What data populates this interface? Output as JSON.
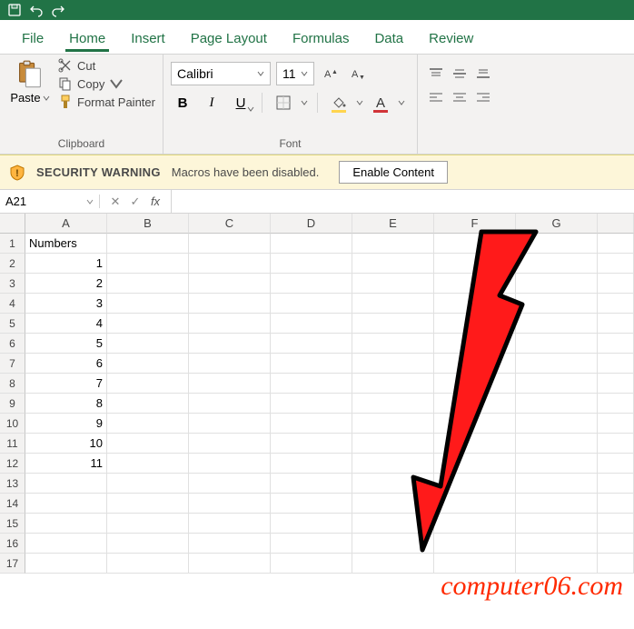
{
  "tabs": {
    "file": "File",
    "home": "Home",
    "insert": "Insert",
    "pageLayout": "Page Layout",
    "formulas": "Formulas",
    "data": "Data",
    "review": "Review"
  },
  "clipboard": {
    "paste": "Paste",
    "cut": "Cut",
    "copy": "Copy",
    "formatPainter": "Format Painter",
    "groupLabel": "Clipboard"
  },
  "font": {
    "name": "Calibri",
    "size": "11",
    "bold": "B",
    "italic": "I",
    "underline": "U",
    "fontColor": "#d13438",
    "fillColor": "#ffd54f",
    "groupLabel": "Font"
  },
  "security": {
    "title": "SECURITY WARNING",
    "message": "Macros have been disabled.",
    "enable": "Enable Content"
  },
  "formulaBar": {
    "nameBox": "A21",
    "cancel": "✕",
    "confirm": "✓",
    "fx": "fx",
    "value": ""
  },
  "grid": {
    "columns": [
      "A",
      "B",
      "C",
      "D",
      "E",
      "F",
      "G"
    ],
    "rowCount": 17,
    "header": "Numbers",
    "values": [
      1,
      2,
      3,
      4,
      5,
      6,
      7,
      8,
      9,
      10,
      11
    ]
  },
  "chart_data": {
    "type": "table",
    "columns": [
      "Numbers"
    ],
    "rows": [
      [
        1
      ],
      [
        2
      ],
      [
        3
      ],
      [
        4
      ],
      [
        5
      ],
      [
        6
      ],
      [
        7
      ],
      [
        8
      ],
      [
        9
      ],
      [
        10
      ],
      [
        11
      ]
    ]
  },
  "watermark": "computer06.com"
}
